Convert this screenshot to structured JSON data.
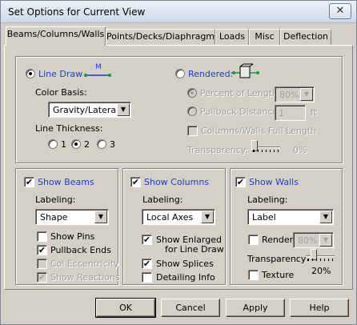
{
  "window": {
    "title": "Set Options for Current View",
    "close_glyph": "✕"
  },
  "tabs": [
    "Beams/Columns/Walls",
    "Points/Decks/Diaphragms",
    "Loads",
    "Misc",
    "Deflection"
  ],
  "draw": {
    "line_draw_label": "Line Draw",
    "line_draw_icon_label": "M",
    "rendered_label": "Rendered:",
    "color_basis_label": "Color Basis:",
    "color_basis_value": "Gravity/Lateral",
    "line_thickness_label": "Line Thickness:",
    "thickness_options": [
      "1",
      "2",
      "3"
    ],
    "thickness_selected": "2",
    "percent_length_label": "Percent of Length",
    "percent_length_value": "80%",
    "pullback_label": "Pullback Distance",
    "pullback_value": "1",
    "pullback_unit": "ft",
    "full_length_label": "Columns/Walls Full Length",
    "transparency_label": "Transparency:",
    "transparency_value": "0%"
  },
  "beams": {
    "title": "Show Beams",
    "labeling_label": "Labeling:",
    "labeling_value": "Shape",
    "show_pins": "Show Pins",
    "pullback_ends": "Pullback Ends",
    "col_eccentricity": "Col Eccentricity",
    "show_reactions": "Show Reactions"
  },
  "columns": {
    "title": "Show Columns",
    "labeling_label": "Labeling:",
    "labeling_value": "Local Axes",
    "show_enlarged": "Show Enlarged",
    "for_line_draw": "for Line Draw",
    "show_splices": "Show Splices",
    "detailing_info": "Detailing Info"
  },
  "walls": {
    "title": "Show Walls",
    "labeling_label": "Labeling:",
    "labeling_value": "Label",
    "render_label": "Render",
    "render_value": "80%",
    "transparency_label": "Transparency",
    "transparency_value": "20%",
    "texture_label": "Texture"
  },
  "buttons": {
    "ok": "OK",
    "cancel": "Cancel",
    "apply": "Apply",
    "help": "Help"
  },
  "glyphs": {
    "check": "✔",
    "arrow": "▼"
  },
  "colors": {
    "accent_text": "#1f3fbf",
    "disabled_text": "#a0a0a0",
    "face": "#d4d0c8"
  }
}
